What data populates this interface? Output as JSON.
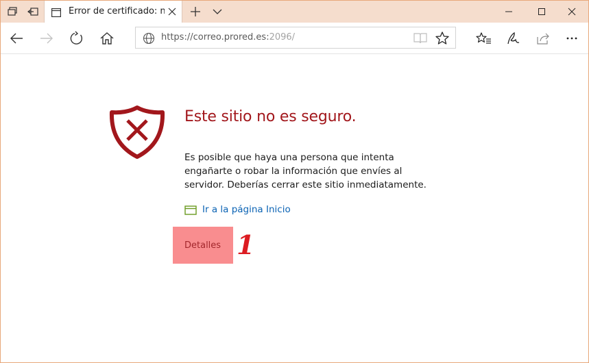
{
  "tab": {
    "title": "Error de certificado: nav"
  },
  "address": {
    "url_main": "https://correo.prored.es:",
    "url_port": "2096/"
  },
  "error": {
    "title": "Este sitio no es seguro.",
    "description": "Es posible que haya una persona que intenta engañarte o robar la información que envíes al servidor. Deberías cerrar este sitio inmediatamente.",
    "home_link": "Ir a la página Inicio",
    "details_button": "Detalles",
    "annotation": "1"
  },
  "colors": {
    "title_red": "#a2171c",
    "link_blue": "#0b63b4",
    "details_highlight": "#f98d8f",
    "annotation_red": "#dc1c22",
    "tabbar_bg": "#f5ddcd"
  },
  "icons": {
    "tab_manager": "tab-manager-icon",
    "set_aside": "set-aside-tabs-icon",
    "page": "page-icon",
    "close": "close-icon",
    "new_tab": "plus-icon",
    "tab_list": "chevron-down-icon",
    "minimize": "minimize-icon",
    "maximize": "maximize-icon",
    "window_close": "window-close-icon",
    "back": "back-arrow-icon",
    "forward": "forward-arrow-icon",
    "refresh": "refresh-icon",
    "home": "home-icon",
    "globe": "globe-icon",
    "reading_view": "reading-view-icon",
    "favorite": "star-icon",
    "favorites_hub": "favorites-hub-icon",
    "web_note": "pen-icon",
    "share": "share-icon",
    "more": "more-dots-icon",
    "shield": "shield-x-icon",
    "home_link": "window-green-icon"
  }
}
